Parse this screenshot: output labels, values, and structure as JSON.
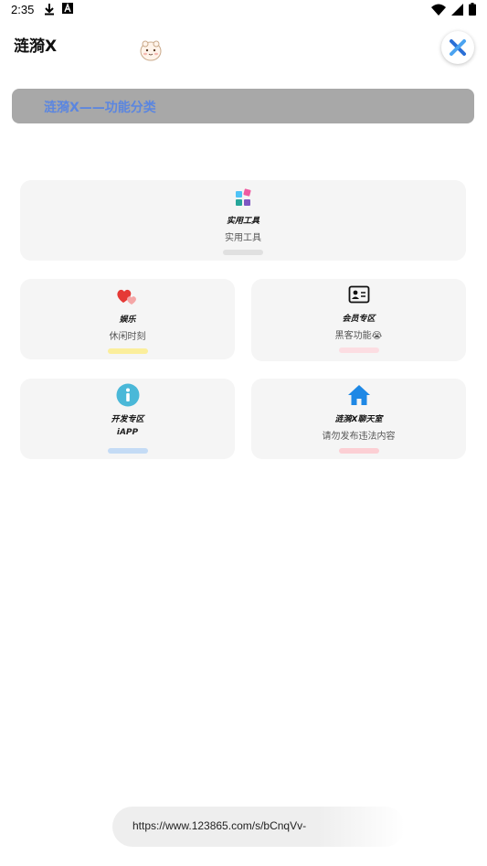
{
  "status_bar": {
    "time": "2:35",
    "icons": [
      "download-icon",
      "a-box-icon",
      "wifi-icon",
      "signal-icon",
      "battery-icon"
    ]
  },
  "header": {
    "title": "涟漪X",
    "mascot_icon": "mascot-sticker",
    "close_icon": "x-logo-icon"
  },
  "banner": {
    "text": "涟漪X——功能分类"
  },
  "cards": [
    {
      "title": "实用工具",
      "subtitle": "实用工具",
      "icon": "blocks-icon",
      "bar_color": "#e0e0e0"
    },
    {
      "title": "娱乐",
      "subtitle": "休闲时刻",
      "icon": "hearts-icon",
      "bar_color": "#fbee9c"
    },
    {
      "title": "会员专区",
      "subtitle": "黑客功能😭",
      "icon": "id-card-icon",
      "bar_color": "#fcdde2"
    },
    {
      "title": "开发专区",
      "subtitle": "iAPP",
      "icon": "info-icon",
      "bar_color": "#c4dbf5"
    },
    {
      "title": "涟漪X聊天室",
      "subtitle": "请勿发布违法内容",
      "icon": "home-icon",
      "bar_color": "#fccfd4"
    }
  ],
  "url_toast": {
    "text": "https://www.123865.com/s/bCnqVv-"
  },
  "colors": {
    "banner_bg": "#a8a8a8",
    "banner_text": "#5b86e0",
    "card_bg": "#f5f5f5",
    "close_x": "#2a6fd6"
  }
}
